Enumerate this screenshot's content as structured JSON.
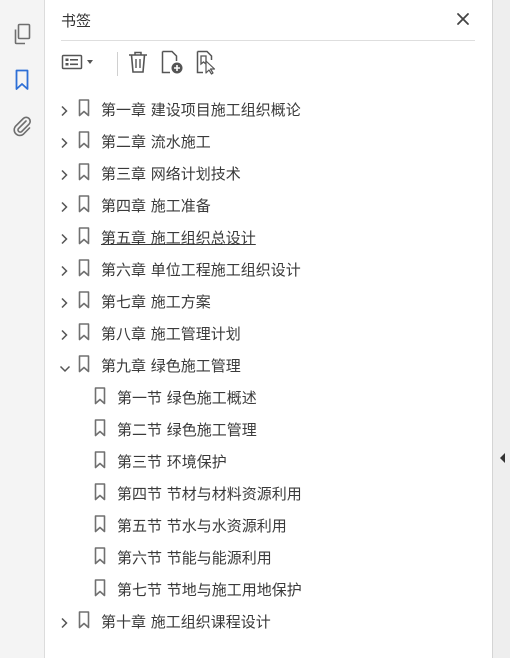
{
  "panel": {
    "title": "书签"
  },
  "rail": {
    "icons": [
      "pages-icon",
      "bookmark-icon",
      "attachment-icon"
    ]
  },
  "toolbar": {
    "icons": [
      "options-menu-icon",
      "delete-icon",
      "new-bookmark-icon",
      "find-bookmark-icon"
    ]
  },
  "colors": {
    "accent": "#2d6fd6",
    "text": "#3a3a3a",
    "icon": "#6e6e6e"
  },
  "bookmarks": [
    {
      "label": "第一章  建设项目施工组织概论",
      "expanded": false
    },
    {
      "label": "第二章  流水施工",
      "expanded": false
    },
    {
      "label": "第三章  网络计划技术",
      "expanded": false
    },
    {
      "label": "第四章  施工准备",
      "expanded": false
    },
    {
      "label": "第五章  施工组织总设计",
      "expanded": false,
      "hovered": true
    },
    {
      "label": "第六章  单位工程施工组织设计",
      "expanded": false
    },
    {
      "label": "第七章  施工方案",
      "expanded": false
    },
    {
      "label": "第八章  施工管理计划",
      "expanded": false
    },
    {
      "label": "第九章  绿色施工管理",
      "expanded": true,
      "children": [
        {
          "label": "第一节  绿色施工概述"
        },
        {
          "label": "第二节  绿色施工管理"
        },
        {
          "label": "第三节  环境保护"
        },
        {
          "label": "第四节  节材与材料资源利用"
        },
        {
          "label": "第五节  节水与水资源利用"
        },
        {
          "label": "第六节  节能与能源利用"
        },
        {
          "label": "第七节  节地与施工用地保护"
        }
      ]
    },
    {
      "label": "第十章  施工组织课程设计",
      "expanded": false
    }
  ]
}
